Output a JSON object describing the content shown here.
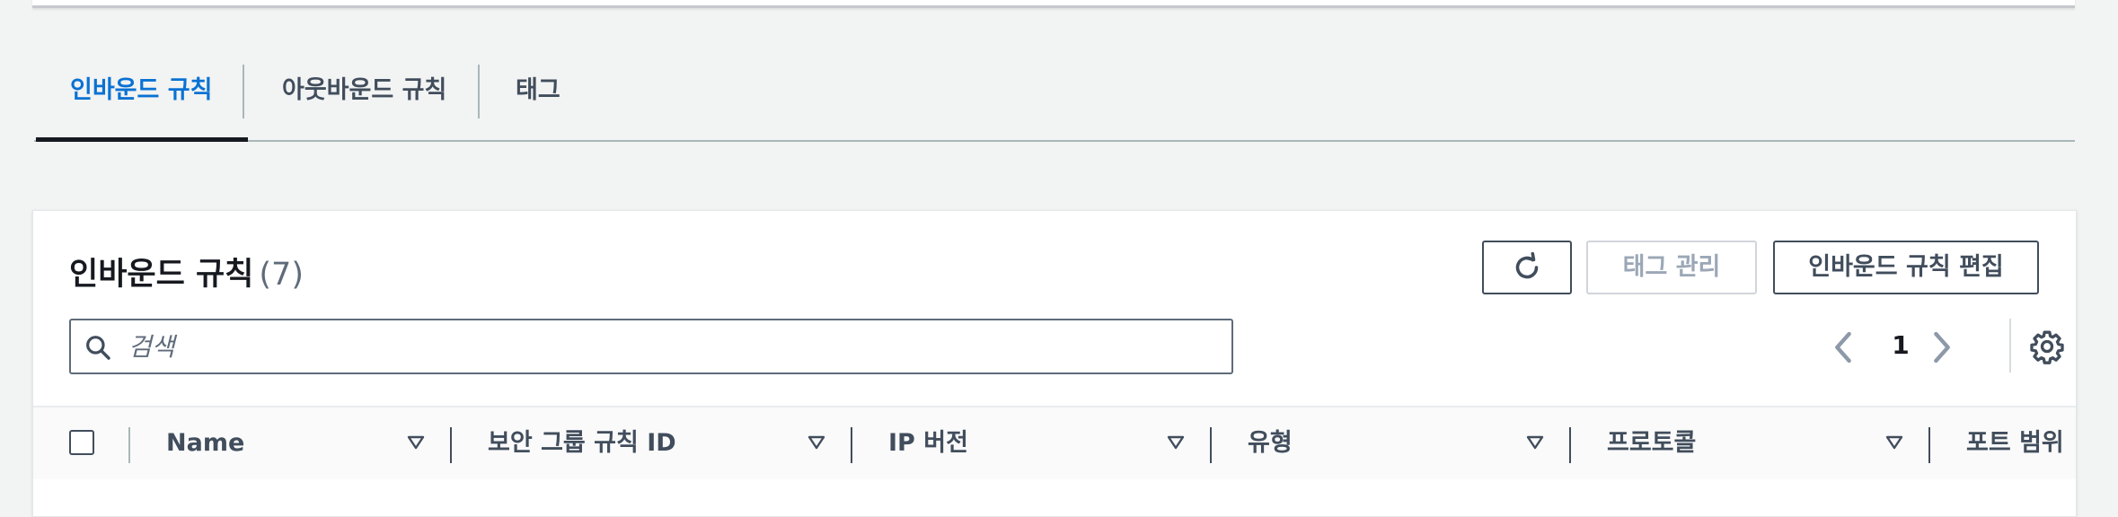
{
  "tabs": [
    {
      "label": "인바운드 규칙",
      "active": true
    },
    {
      "label": "아웃바운드 규칙",
      "active": false
    },
    {
      "label": "태그",
      "active": false
    }
  ],
  "panel": {
    "title": "인바운드 규칙",
    "count": "(7)",
    "buttons": {
      "refresh_icon": "refresh-icon",
      "manage_tags": "태그 관리",
      "edit_inbound_rules": "인바운드 규칙 편집"
    },
    "search": {
      "placeholder": "검색",
      "value": ""
    },
    "pagination": {
      "current_page": "1"
    }
  },
  "table": {
    "columns": [
      {
        "label": "Name"
      },
      {
        "label": "보안 그룹 규칙 ID"
      },
      {
        "label": "IP 버전"
      },
      {
        "label": "유형"
      },
      {
        "label": "프로토콜"
      },
      {
        "label": "포트 범위"
      }
    ]
  },
  "colors": {
    "active_tab": "#0972d3",
    "text_primary": "#16191f",
    "text_secondary": "#414d5c",
    "disabled": "#9ba7b6",
    "background": "#f2f3f3"
  }
}
